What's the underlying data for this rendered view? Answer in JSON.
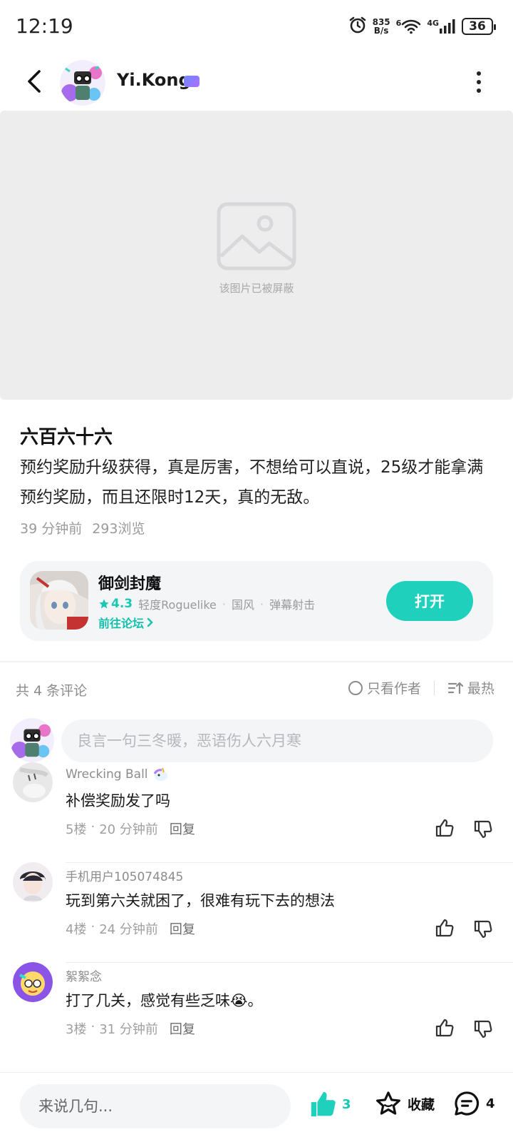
{
  "status_bar": {
    "time": "12:19",
    "net_speed_top": "835",
    "net_speed_bottom": "B/s",
    "wifi_label": "6",
    "network_type": "4G",
    "battery": "36"
  },
  "header": {
    "author_name": "Yi.Kong"
  },
  "blocked_image": {
    "text": "该图片已被屏蔽"
  },
  "post": {
    "title": "六百六十六",
    "body": "预约奖励升级获得，真是厉害，不想给可以直说，25级才能拿满预约奖励，而且还限时12天，真的无敌。",
    "time": "39 分钟前",
    "views": "293浏览"
  },
  "game_card": {
    "name": "御剑封魔",
    "rating": "4.3",
    "tags": [
      "轻度Roguelike",
      "国风",
      "弹幕射击"
    ],
    "tag_separator": "·",
    "forum_link": "前往论坛",
    "open_label": "打开"
  },
  "comments_header": {
    "count_text": "共 4 条评论",
    "author_only": "只看作者",
    "sort": "最热"
  },
  "comment_input": {
    "placeholder": "良言一句三冬暖，恶语伤人六月寒"
  },
  "comments": [
    {
      "name": "Wrecking Ball",
      "text": "补偿奖励发了吗",
      "floor": "5楼",
      "sep": "·",
      "time": "20 分钟前",
      "reply": "回复"
    },
    {
      "name": "手机用户105074845",
      "text": "玩到第六关就困了，很难有玩下去的想法",
      "floor": "4楼",
      "sep": "·",
      "time": "24 分钟前",
      "reply": "回复"
    },
    {
      "name": "絮絮念",
      "text": "打了几关，感觉有些乏味😭。",
      "floor": "3楼",
      "sep": "·",
      "time": "31 分钟前",
      "reply": "回复"
    }
  ],
  "bottom_bar": {
    "placeholder": "来说几句...",
    "like_count": "3",
    "favorite_label": "收藏",
    "comment_count": "4"
  },
  "colors": {
    "accent": "#1fd0bd",
    "accent_text": "#14c0ad",
    "card_bg": "#f3f5f7",
    "blocked_bg": "#ededee"
  }
}
